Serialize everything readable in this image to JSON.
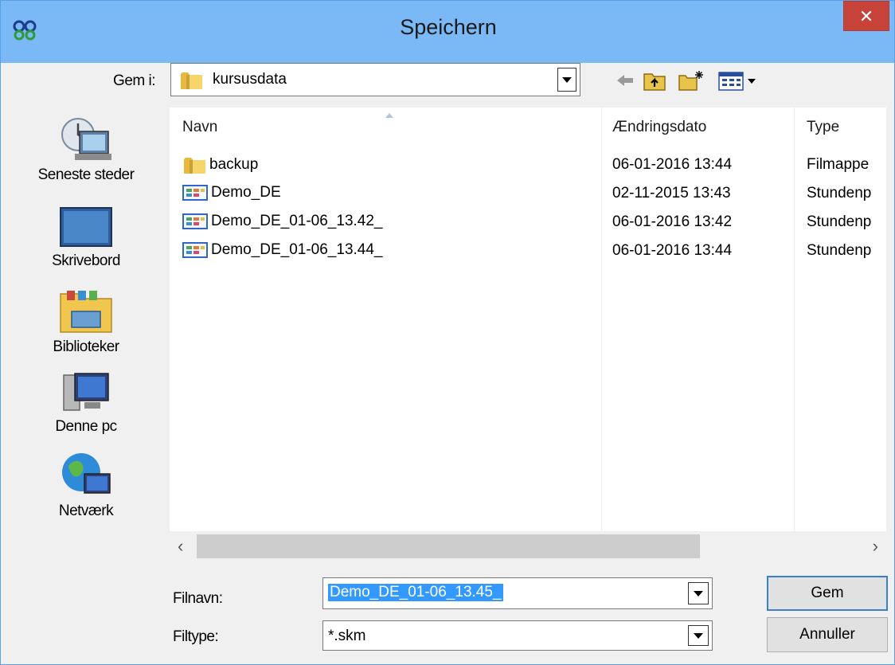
{
  "window": {
    "title": "Speichern",
    "close_label": "✕"
  },
  "look_in": {
    "label": "Gem i:",
    "value": "kursusdata"
  },
  "toolbar": {
    "icons": [
      "back-arrow-icon",
      "up-folder-icon",
      "new-folder-icon",
      "view-menu-icon"
    ]
  },
  "places": [
    {
      "label": "Seneste steder",
      "icon": "recent-places-icon"
    },
    {
      "label": "Skrivebord",
      "icon": "desktop-icon"
    },
    {
      "label": "Biblioteker",
      "icon": "libraries-icon"
    },
    {
      "label": "Denne pc",
      "icon": "this-pc-icon"
    },
    {
      "label": "Netværk",
      "icon": "network-icon"
    }
  ],
  "file_list": {
    "columns": [
      "Navn",
      "Ændringsdato",
      "Type"
    ],
    "rows": [
      {
        "name": "backup",
        "date": "06-01-2016 13:44",
        "type": "Filmappe",
        "icon": "folder-icon"
      },
      {
        "name": "Demo_DE",
        "date": "02-11-2015 13:43",
        "type": "Stundenp",
        "icon": "schedule-file-icon"
      },
      {
        "name": "Demo_DE_01-06_13.42_",
        "date": "06-01-2016 13:42",
        "type": "Stundenp",
        "icon": "schedule-file-icon"
      },
      {
        "name": "Demo_DE_01-06_13.44_",
        "date": "06-01-2016 13:44",
        "type": "Stundenp",
        "icon": "schedule-file-icon"
      }
    ]
  },
  "scroll": {
    "left": "‹",
    "right": "›"
  },
  "filename": {
    "label": "Filnavn:",
    "value": "Demo_DE_01-06_13.45_"
  },
  "filetype": {
    "label": "Filtype:",
    "value": "*.skm"
  },
  "buttons": {
    "save": "Gem",
    "cancel": "Annuller"
  }
}
